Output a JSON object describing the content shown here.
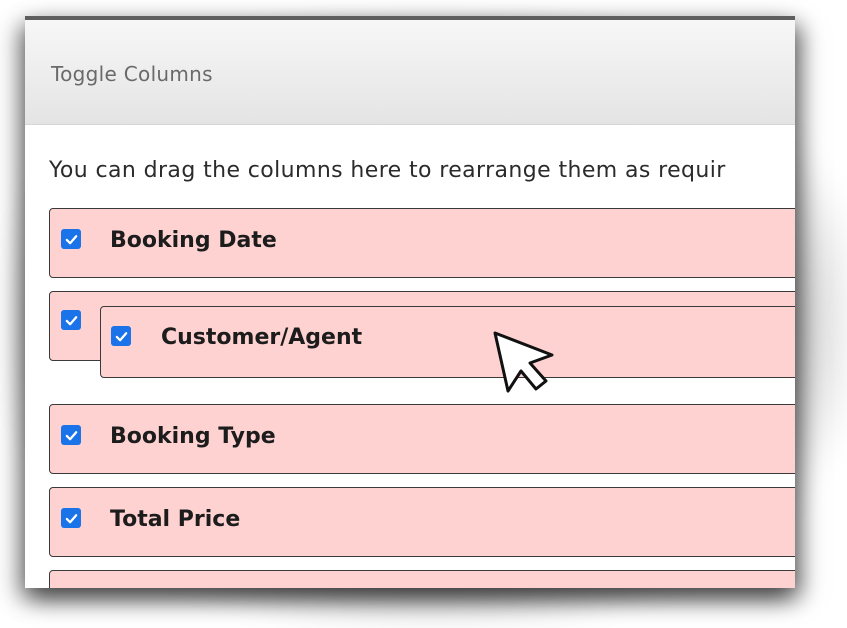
{
  "dialog": {
    "title": "Toggle Columns",
    "instructions": "You can drag the columns here to rearrange them as requir"
  },
  "columns": [
    {
      "label": "Booking Date",
      "checked": true
    },
    {
      "label": "Customer/Agent",
      "checked": true
    },
    {
      "label": "Booking Type",
      "checked": true
    },
    {
      "label": "Total Price",
      "checked": true
    },
    {
      "label": "",
      "checked": true
    }
  ],
  "dragging_item": {
    "label": "Customer/Agent",
    "checked": true
  },
  "colors": {
    "row_background": "#ffd2d2",
    "checkbox": "#1a73e8",
    "header_border": "#5e5e5e"
  },
  "icons": {
    "checkbox": "checkmark-icon",
    "cursor": "mouse-pointer-icon"
  }
}
